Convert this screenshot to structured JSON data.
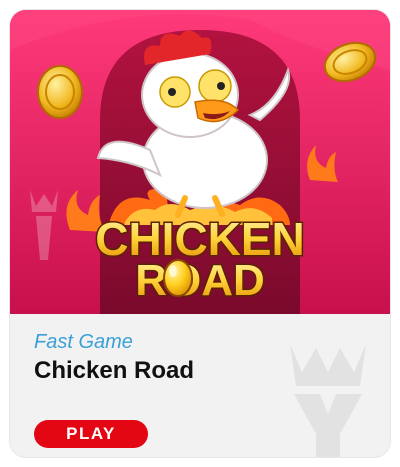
{
  "game_card": {
    "logo_line1": "CHICKEN",
    "logo_line2": "ROAD",
    "category": "Fast Game",
    "title": "Chicken Road",
    "play_label": "PLAY"
  },
  "colors": {
    "art_background": "#e01f5f",
    "category_text": "#3aa0d6",
    "play_button": "#e30613"
  }
}
